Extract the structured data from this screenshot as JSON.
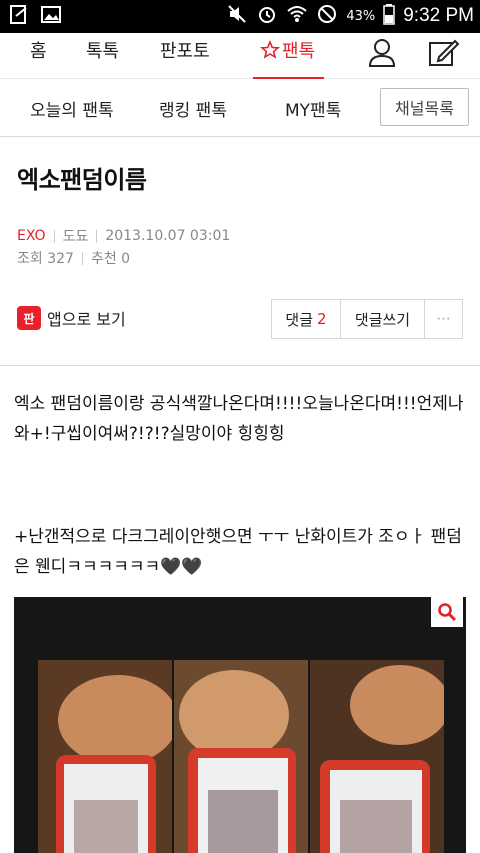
{
  "status_bar": {
    "battery_percent": "43%",
    "time": "9:32 PM",
    "icons": [
      "notes-icon",
      "image-icon",
      "mute-icon",
      "alarm-icon",
      "wifi-icon",
      "blocked-icon",
      "battery-icon"
    ]
  },
  "top_nav": {
    "tabs": [
      {
        "label": "홈"
      },
      {
        "label": "톡톡"
      },
      {
        "label": "판포토"
      },
      {
        "label": "팬톡",
        "icon": "star-outline-icon",
        "active": true
      }
    ],
    "icons": [
      "user-icon",
      "compose-icon"
    ],
    "accent_color": "#e8202a"
  },
  "sub_nav": {
    "tabs": [
      "오늘의 팬톡",
      "랭킹 팬톡",
      "MY팬톡"
    ],
    "channel_button": "채널목록"
  },
  "post": {
    "title": "엑소팬덤이름",
    "channel": "EXO",
    "author": "도됴",
    "date": "2013.10.07 03:01",
    "views": "조회 327",
    "recommends": "추천 0",
    "app_logo_text": "판",
    "app_view_label": "앱으로 보기",
    "comments_label": "댓글",
    "comments_count": "2",
    "write_comment_label": "댓글쓰기",
    "more_label": "···",
    "paragraphs": [
      "엑소 팬덤이름이랑 공식색깔나온다며!!!!오늘나온다며!!!언제나와+!구씹이여써?!?!?실망이야 힝힝힝",
      "+난갠적으로 다크그레이안햇으면 ㅜㅜ 난화이트가 조ㅇㅏ 팬덤은 웬디ㅋㅋㅋㅋㅋㅋ🖤🖤"
    ]
  }
}
